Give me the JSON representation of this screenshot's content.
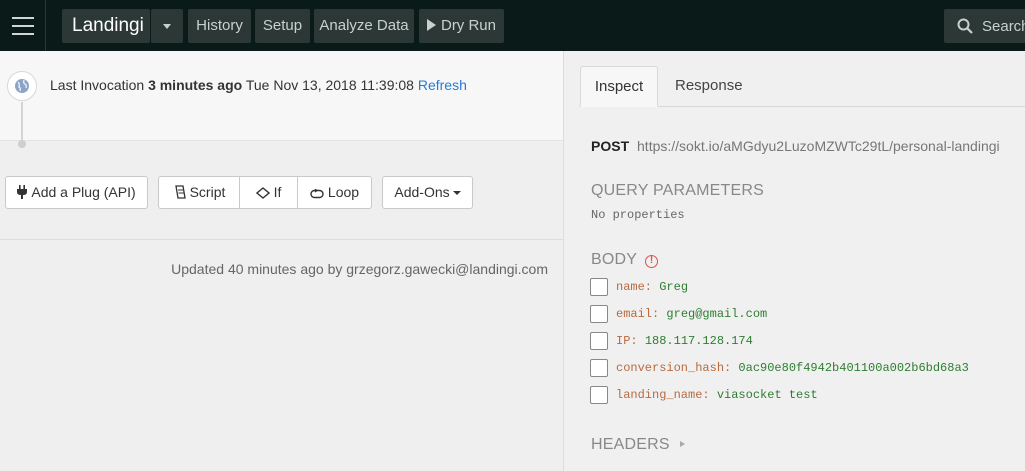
{
  "topbar": {
    "title": "Landingi",
    "buttons": {
      "history": "History",
      "setup": "Setup",
      "analyze": "Analyze Data",
      "dry_run": "Dry Run"
    },
    "search_placeholder": "Search",
    "background": "#0a1a18"
  },
  "invocation": {
    "prefix": "Last Invocation",
    "relative": "3 minutes ago",
    "timestamp": "Tue Nov 13, 2018 11:39:08",
    "refresh": "Refresh"
  },
  "actions": {
    "add_plug": "Add a Plug (API)",
    "script": "Script",
    "if": "If",
    "loop": "Loop",
    "addons": "Add-Ons"
  },
  "updated": "Updated 40 minutes ago by grzegorz.gawecki@landingi.com",
  "inspector": {
    "tabs": {
      "inspect": "Inspect",
      "response": "Response"
    },
    "method": "POST",
    "url": "https://sokt.io/aMGdyu2LuzoMZWTc29tL/personal-landingi",
    "query_title": "QUERY PARAMETERS",
    "no_properties": "No properties",
    "body_title": "BODY",
    "body": [
      {
        "key": "name:",
        "value": "Greg"
      },
      {
        "key": "email:",
        "value": "greg@gmail.com"
      },
      {
        "key": "IP:",
        "value": "188.117.128.174"
      },
      {
        "key": "conversion_hash:",
        "value": "0ac90e80f4942b401100a002b6bd68a3"
      },
      {
        "key": "landing_name:",
        "value": "viasocket test"
      }
    ],
    "headers_title": "HEADERS"
  },
  "colors": {
    "link": "#2a7ad4",
    "json_key": "#b86a3f",
    "json_value": "#2e7d32",
    "warning": "#d9534f"
  }
}
